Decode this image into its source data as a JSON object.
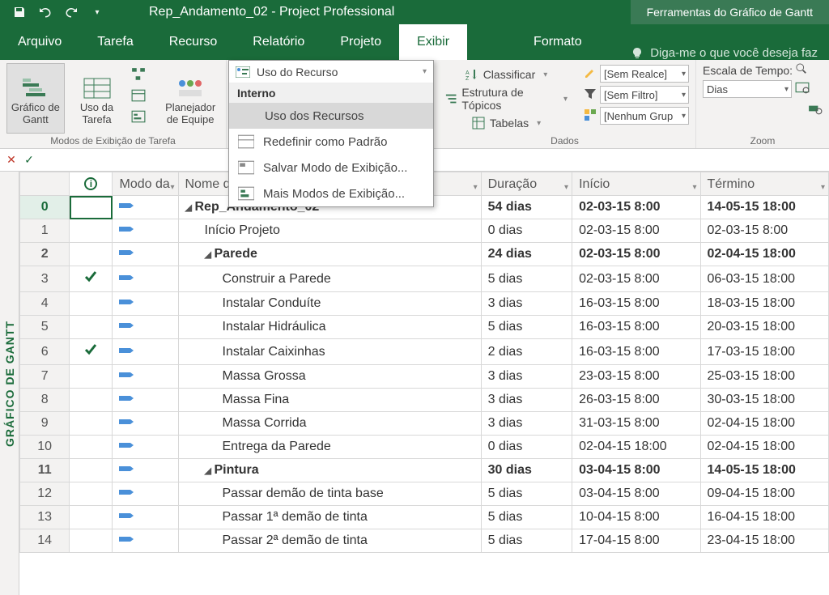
{
  "titlebar": {
    "title": "Rep_Andamento_02 - Project Professional",
    "contextual": "Ferramentas do Gráfico de Gantt"
  },
  "tabs": {
    "arquivo": "Arquivo",
    "tarefa": "Tarefa",
    "recurso": "Recurso",
    "relatorio": "Relatório",
    "projeto": "Projeto",
    "exibir": "Exibir",
    "formato": "Formato",
    "tellme": "Diga-me o que você deseja faz"
  },
  "ribbon": {
    "gantt": "Gráfico de Gantt",
    "uso_tarefa": "Uso da Tarefa",
    "planejador": "Planejador de Equipe",
    "group_modos": "Modos de Exibição de Tarefa",
    "group_dados": "Dados",
    "group_zoom": "Zoom",
    "classificar": "Classificar",
    "estrutura": "Estrutura de Tópicos",
    "tabelas": "Tabelas",
    "realce": "[Sem Realce]",
    "filtro": "[Sem Filtro]",
    "grupo": "[Nenhum Grup",
    "escala_label": "Escala de Tempo:",
    "escala_value": "Dias"
  },
  "dropdown": {
    "trigger": "Uso do Recurso",
    "section": "Interno",
    "item_uso": "Uso dos Recursos",
    "item_redefinir": "Redefinir como Padrão",
    "item_salvar": "Salvar Modo de Exibição...",
    "item_mais": "Mais Modos de Exibição..."
  },
  "sidebar": {
    "label": "GRÁFICO DE GANTT"
  },
  "headers": {
    "modo": "Modo da",
    "nome": "Nome da tarefa",
    "duracao": "Duração",
    "inicio": "Início",
    "termino": "Término"
  },
  "rows": [
    {
      "id": "0",
      "check": false,
      "level": 0,
      "expander": "◢",
      "name": "Rep_Andamento_02",
      "dur": "54 dias",
      "start": "02-03-15 8:00",
      "end": "14-05-15 18:00",
      "summary": true
    },
    {
      "id": "1",
      "check": false,
      "level": 1,
      "expander": "",
      "name": "Início Projeto",
      "dur": "0 dias",
      "start": "02-03-15 8:00",
      "end": "02-03-15 8:00",
      "summary": false
    },
    {
      "id": "2",
      "check": false,
      "level": 1,
      "expander": "◢",
      "name": "Parede",
      "dur": "24 dias",
      "start": "02-03-15 8:00",
      "end": "02-04-15 18:00",
      "summary": true
    },
    {
      "id": "3",
      "check": true,
      "level": 2,
      "expander": "",
      "name": "Construir a Parede",
      "dur": "5 dias",
      "start": "02-03-15 8:00",
      "end": "06-03-15 18:00",
      "summary": false
    },
    {
      "id": "4",
      "check": false,
      "level": 2,
      "expander": "",
      "name": "Instalar Conduíte",
      "dur": "3 dias",
      "start": "16-03-15 8:00",
      "end": "18-03-15 18:00",
      "summary": false
    },
    {
      "id": "5",
      "check": false,
      "level": 2,
      "expander": "",
      "name": "Instalar Hidráulica",
      "dur": "5 dias",
      "start": "16-03-15 8:00",
      "end": "20-03-15 18:00",
      "summary": false
    },
    {
      "id": "6",
      "check": true,
      "level": 2,
      "expander": "",
      "name": "Instalar Caixinhas",
      "dur": "2 dias",
      "start": "16-03-15 8:00",
      "end": "17-03-15 18:00",
      "summary": false
    },
    {
      "id": "7",
      "check": false,
      "level": 2,
      "expander": "",
      "name": "Massa Grossa",
      "dur": "3 dias",
      "start": "23-03-15 8:00",
      "end": "25-03-15 18:00",
      "summary": false
    },
    {
      "id": "8",
      "check": false,
      "level": 2,
      "expander": "",
      "name": "Massa Fina",
      "dur": "3 dias",
      "start": "26-03-15 8:00",
      "end": "30-03-15 18:00",
      "summary": false
    },
    {
      "id": "9",
      "check": false,
      "level": 2,
      "expander": "",
      "name": "Massa Corrida",
      "dur": "3 dias",
      "start": "31-03-15 8:00",
      "end": "02-04-15 18:00",
      "summary": false
    },
    {
      "id": "10",
      "check": false,
      "level": 2,
      "expander": "",
      "name": "Entrega da Parede",
      "dur": "0 dias",
      "start": "02-04-15 18:00",
      "end": "02-04-15 18:00",
      "summary": false
    },
    {
      "id": "11",
      "check": false,
      "level": 1,
      "expander": "◢",
      "name": "Pintura",
      "dur": "30 dias",
      "start": "03-04-15 8:00",
      "end": "14-05-15 18:00",
      "summary": true
    },
    {
      "id": "12",
      "check": false,
      "level": 2,
      "expander": "",
      "name": "Passar demão de tinta base",
      "dur": "5 dias",
      "start": "03-04-15 8:00",
      "end": "09-04-15 18:00",
      "summary": false
    },
    {
      "id": "13",
      "check": false,
      "level": 2,
      "expander": "",
      "name": "Passar 1ª demão de tinta",
      "dur": "5 dias",
      "start": "10-04-15 8:00",
      "end": "16-04-15 18:00",
      "summary": false
    },
    {
      "id": "14",
      "check": false,
      "level": 2,
      "expander": "",
      "name": "Passar 2ª demão de tinta",
      "dur": "5 dias",
      "start": "17-04-15 8:00",
      "end": "23-04-15 18:00",
      "summary": false
    }
  ]
}
